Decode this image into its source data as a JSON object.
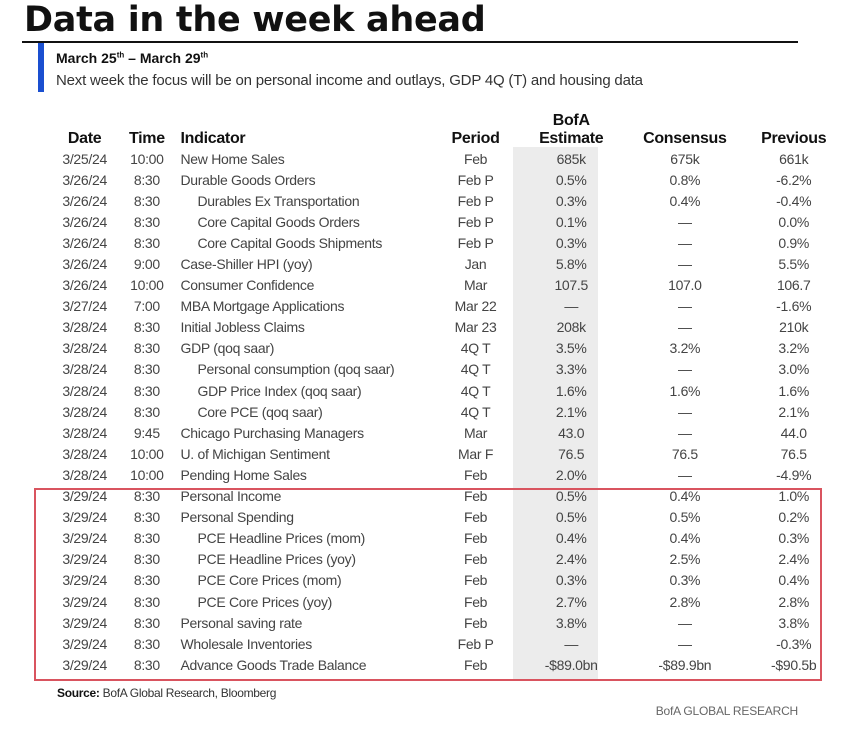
{
  "header": {
    "title": "Data in the week ahead",
    "date_range_start": "March 25",
    "date_range_start_suffix": "th",
    "date_range_separator": " – ",
    "date_range_end": "March 29",
    "date_range_end_suffix": "th",
    "focus_text": "Next week the focus will be on personal income and outlays, GDP 4Q (T) and housing data"
  },
  "colors": {
    "accent_bar": "#1a4fd0",
    "highlight_box": "#d9545f",
    "estimate_column_shade": "#ececec"
  },
  "table": {
    "columns": {
      "date": "Date",
      "time": "Time",
      "indicator": "Indicator",
      "period": "Period",
      "estimate_line1": "BofA",
      "estimate_line2": "Estimate",
      "consensus": "Consensus",
      "previous": "Previous"
    },
    "rows": [
      {
        "date": "3/25/24",
        "time": "10:00",
        "indicator": "New Home Sales",
        "indent": false,
        "period": "Feb",
        "estimate": "685k",
        "consensus": "675k",
        "previous": "661k"
      },
      {
        "date": "3/26/24",
        "time": "8:30",
        "indicator": "Durable Goods Orders",
        "indent": false,
        "period": "Feb P",
        "estimate": "0.5%",
        "consensus": "0.8%",
        "previous": "-6.2%"
      },
      {
        "date": "3/26/24",
        "time": "8:30",
        "indicator": "Durables Ex Transportation",
        "indent": true,
        "period": "Feb P",
        "estimate": "0.3%",
        "consensus": "0.4%",
        "previous": "-0.4%"
      },
      {
        "date": "3/26/24",
        "time": "8:30",
        "indicator": "Core Capital Goods Orders",
        "indent": true,
        "period": "Feb P",
        "estimate": "0.1%",
        "consensus": "—",
        "previous": "0.0%"
      },
      {
        "date": "3/26/24",
        "time": "8:30",
        "indicator": "Core Capital Goods Shipments",
        "indent": true,
        "period": "Feb P",
        "estimate": "0.3%",
        "consensus": "—",
        "previous": "0.9%"
      },
      {
        "date": "3/26/24",
        "time": "9:00",
        "indicator": "Case-Shiller HPI (yoy)",
        "indent": false,
        "period": "Jan",
        "estimate": "5.8%",
        "consensus": "—",
        "previous": "5.5%"
      },
      {
        "date": "3/26/24",
        "time": "10:00",
        "indicator": "Consumer Confidence",
        "indent": false,
        "period": "Mar",
        "estimate": "107.5",
        "consensus": "107.0",
        "previous": "106.7"
      },
      {
        "date": "3/27/24",
        "time": "7:00",
        "indicator": "MBA Mortgage Applications",
        "indent": false,
        "period": "Mar 22",
        "estimate": "—",
        "consensus": "—",
        "previous": "-1.6%"
      },
      {
        "date": "3/28/24",
        "time": "8:30",
        "indicator": "Initial Jobless Claims",
        "indent": false,
        "period": "Mar 23",
        "estimate": "208k",
        "consensus": "—",
        "previous": "210k"
      },
      {
        "date": "3/28/24",
        "time": "8:30",
        "indicator": "GDP (qoq saar)",
        "indent": false,
        "period": "4Q T",
        "estimate": "3.5%",
        "consensus": "3.2%",
        "previous": "3.2%"
      },
      {
        "date": "3/28/24",
        "time": "8:30",
        "indicator": "Personal consumption (qoq saar)",
        "indent": true,
        "period": "4Q T",
        "estimate": "3.3%",
        "consensus": "—",
        "previous": "3.0%"
      },
      {
        "date": "3/28/24",
        "time": "8:30",
        "indicator": "GDP Price Index (qoq saar)",
        "indent": true,
        "period": "4Q T",
        "estimate": "1.6%",
        "consensus": "1.6%",
        "previous": "1.6%"
      },
      {
        "date": "3/28/24",
        "time": "8:30",
        "indicator": "Core PCE (qoq saar)",
        "indent": true,
        "period": "4Q T",
        "estimate": "2.1%",
        "consensus": "—",
        "previous": "2.1%"
      },
      {
        "date": "3/28/24",
        "time": "9:45",
        "indicator": "Chicago Purchasing Managers",
        "indent": false,
        "period": "Mar",
        "estimate": "43.0",
        "consensus": "—",
        "previous": "44.0"
      },
      {
        "date": "3/28/24",
        "time": "10:00",
        "indicator": "U. of Michigan Sentiment",
        "indent": false,
        "period": "Mar F",
        "estimate": "76.5",
        "consensus": "76.5",
        "previous": "76.5"
      },
      {
        "date": "3/28/24",
        "time": "10:00",
        "indicator": "Pending Home Sales",
        "indent": false,
        "period": "Feb",
        "estimate": "2.0%",
        "consensus": "—",
        "previous": "-4.9%"
      },
      {
        "date": "3/29/24",
        "time": "8:30",
        "indicator": "Personal Income",
        "indent": false,
        "period": "Feb",
        "estimate": "0.5%",
        "consensus": "0.4%",
        "previous": "1.0%"
      },
      {
        "date": "3/29/24",
        "time": "8:30",
        "indicator": "Personal Spending",
        "indent": false,
        "period": "Feb",
        "estimate": "0.5%",
        "consensus": "0.5%",
        "previous": "0.2%"
      },
      {
        "date": "3/29/24",
        "time": "8:30",
        "indicator": "PCE Headline Prices (mom)",
        "indent": true,
        "period": "Feb",
        "estimate": "0.4%",
        "consensus": "0.4%",
        "previous": "0.3%"
      },
      {
        "date": "3/29/24",
        "time": "8:30",
        "indicator": "PCE Headline Prices (yoy)",
        "indent": true,
        "period": "Feb",
        "estimate": "2.4%",
        "consensus": "2.5%",
        "previous": "2.4%"
      },
      {
        "date": "3/29/24",
        "time": "8:30",
        "indicator": "PCE Core Prices (mom)",
        "indent": true,
        "period": "Feb",
        "estimate": "0.3%",
        "consensus": "0.3%",
        "previous": "0.4%"
      },
      {
        "date": "3/29/24",
        "time": "8:30",
        "indicator": "PCE Core Prices (yoy)",
        "indent": true,
        "period": "Feb",
        "estimate": "2.7%",
        "consensus": "2.8%",
        "previous": "2.8%"
      },
      {
        "date": "3/29/24",
        "time": "8:30",
        "indicator": "Personal saving rate",
        "indent": false,
        "period": "Feb",
        "estimate": "3.8%",
        "consensus": "—",
        "previous": "3.8%"
      },
      {
        "date": "3/29/24",
        "time": "8:30",
        "indicator": "Wholesale Inventories",
        "indent": false,
        "period": "Feb P",
        "estimate": "—",
        "consensus": "—",
        "previous": "-0.3%"
      },
      {
        "date": "3/29/24",
        "time": "8:30",
        "indicator": "Advance Goods Trade Balance",
        "indent": false,
        "period": "Feb",
        "estimate": "-$89.0bn",
        "consensus": "-$89.9bn",
        "previous": "-$90.5b"
      }
    ]
  },
  "footer": {
    "source_label": "Source:",
    "source_text": " BofA Global Research, Bloomberg",
    "brand": "BofA GLOBAL RESEARCH"
  }
}
